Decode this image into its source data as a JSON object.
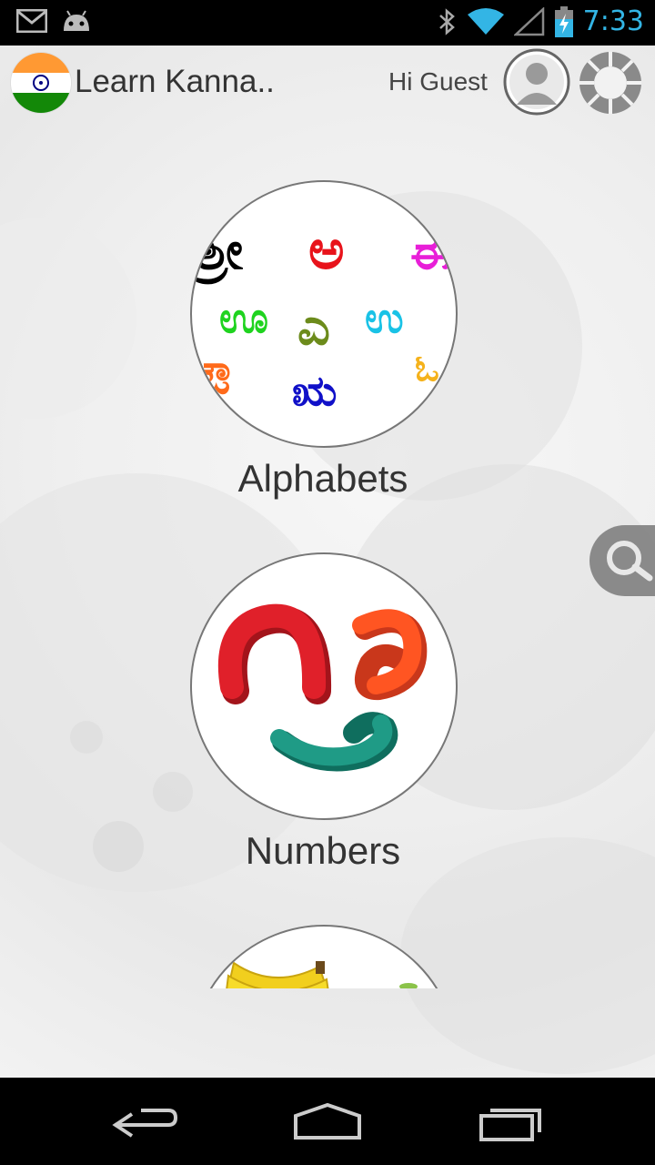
{
  "status_bar": {
    "time": "7:33",
    "icons": [
      "gmail-icon",
      "android-icon",
      "bluetooth-icon",
      "wifi-icon",
      "signal-icon",
      "battery-charging-icon"
    ]
  },
  "header": {
    "title": "Learn Kanna..",
    "greeting": "Hi Guest",
    "flag": "india-flag-icon",
    "avatar": "user-avatar-icon",
    "settings": "settings-ring-icon"
  },
  "menu": [
    {
      "label": "Alphabets"
    },
    {
      "label": "Numbers"
    },
    {
      "label": ""
    }
  ],
  "alphabet_glyphs": [
    {
      "char": "ಶ್ರೀ",
      "color": "#000000"
    },
    {
      "char": "ಅ",
      "color": "#e8131b"
    },
    {
      "char": "ಈ",
      "color": "#e81fd8"
    },
    {
      "char": "ಊ",
      "color": "#1fd31f"
    },
    {
      "char": "ಎ",
      "color": "#6c8b1b"
    },
    {
      "char": "ಉ",
      "color": "#19c2e6"
    },
    {
      "char": "ಔ",
      "color": "#ff6a1a"
    },
    {
      "char": "ಋ",
      "color": "#1010c8"
    },
    {
      "char": "ಓ",
      "color": "#f5b21b"
    }
  ],
  "colors": {
    "accent": "#33b5e5",
    "status_bg": "#000000",
    "nav_bg": "#000000"
  },
  "nav": {
    "back": "back-icon",
    "home": "home-icon",
    "recents": "recent-apps-icon"
  }
}
